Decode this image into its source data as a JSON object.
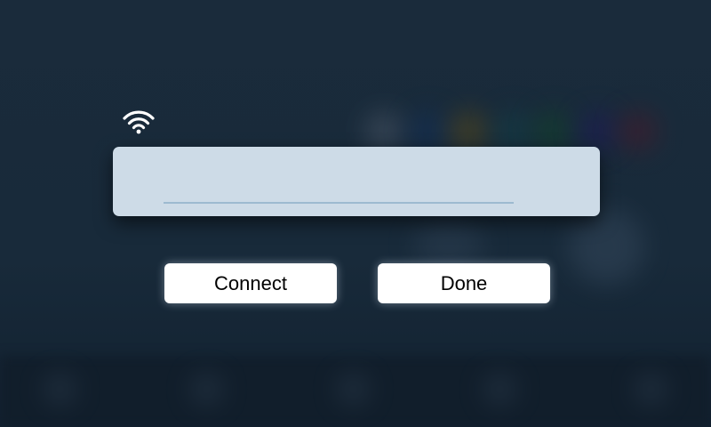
{
  "dialog": {
    "icon": "wifi-icon",
    "input": {
      "value": "",
      "placeholder": ""
    },
    "buttons": {
      "connect": "Connect",
      "done": "Done"
    }
  },
  "colors": {
    "panel": "#cddbe7",
    "background": "#172838",
    "underline": "#9dbad0"
  }
}
